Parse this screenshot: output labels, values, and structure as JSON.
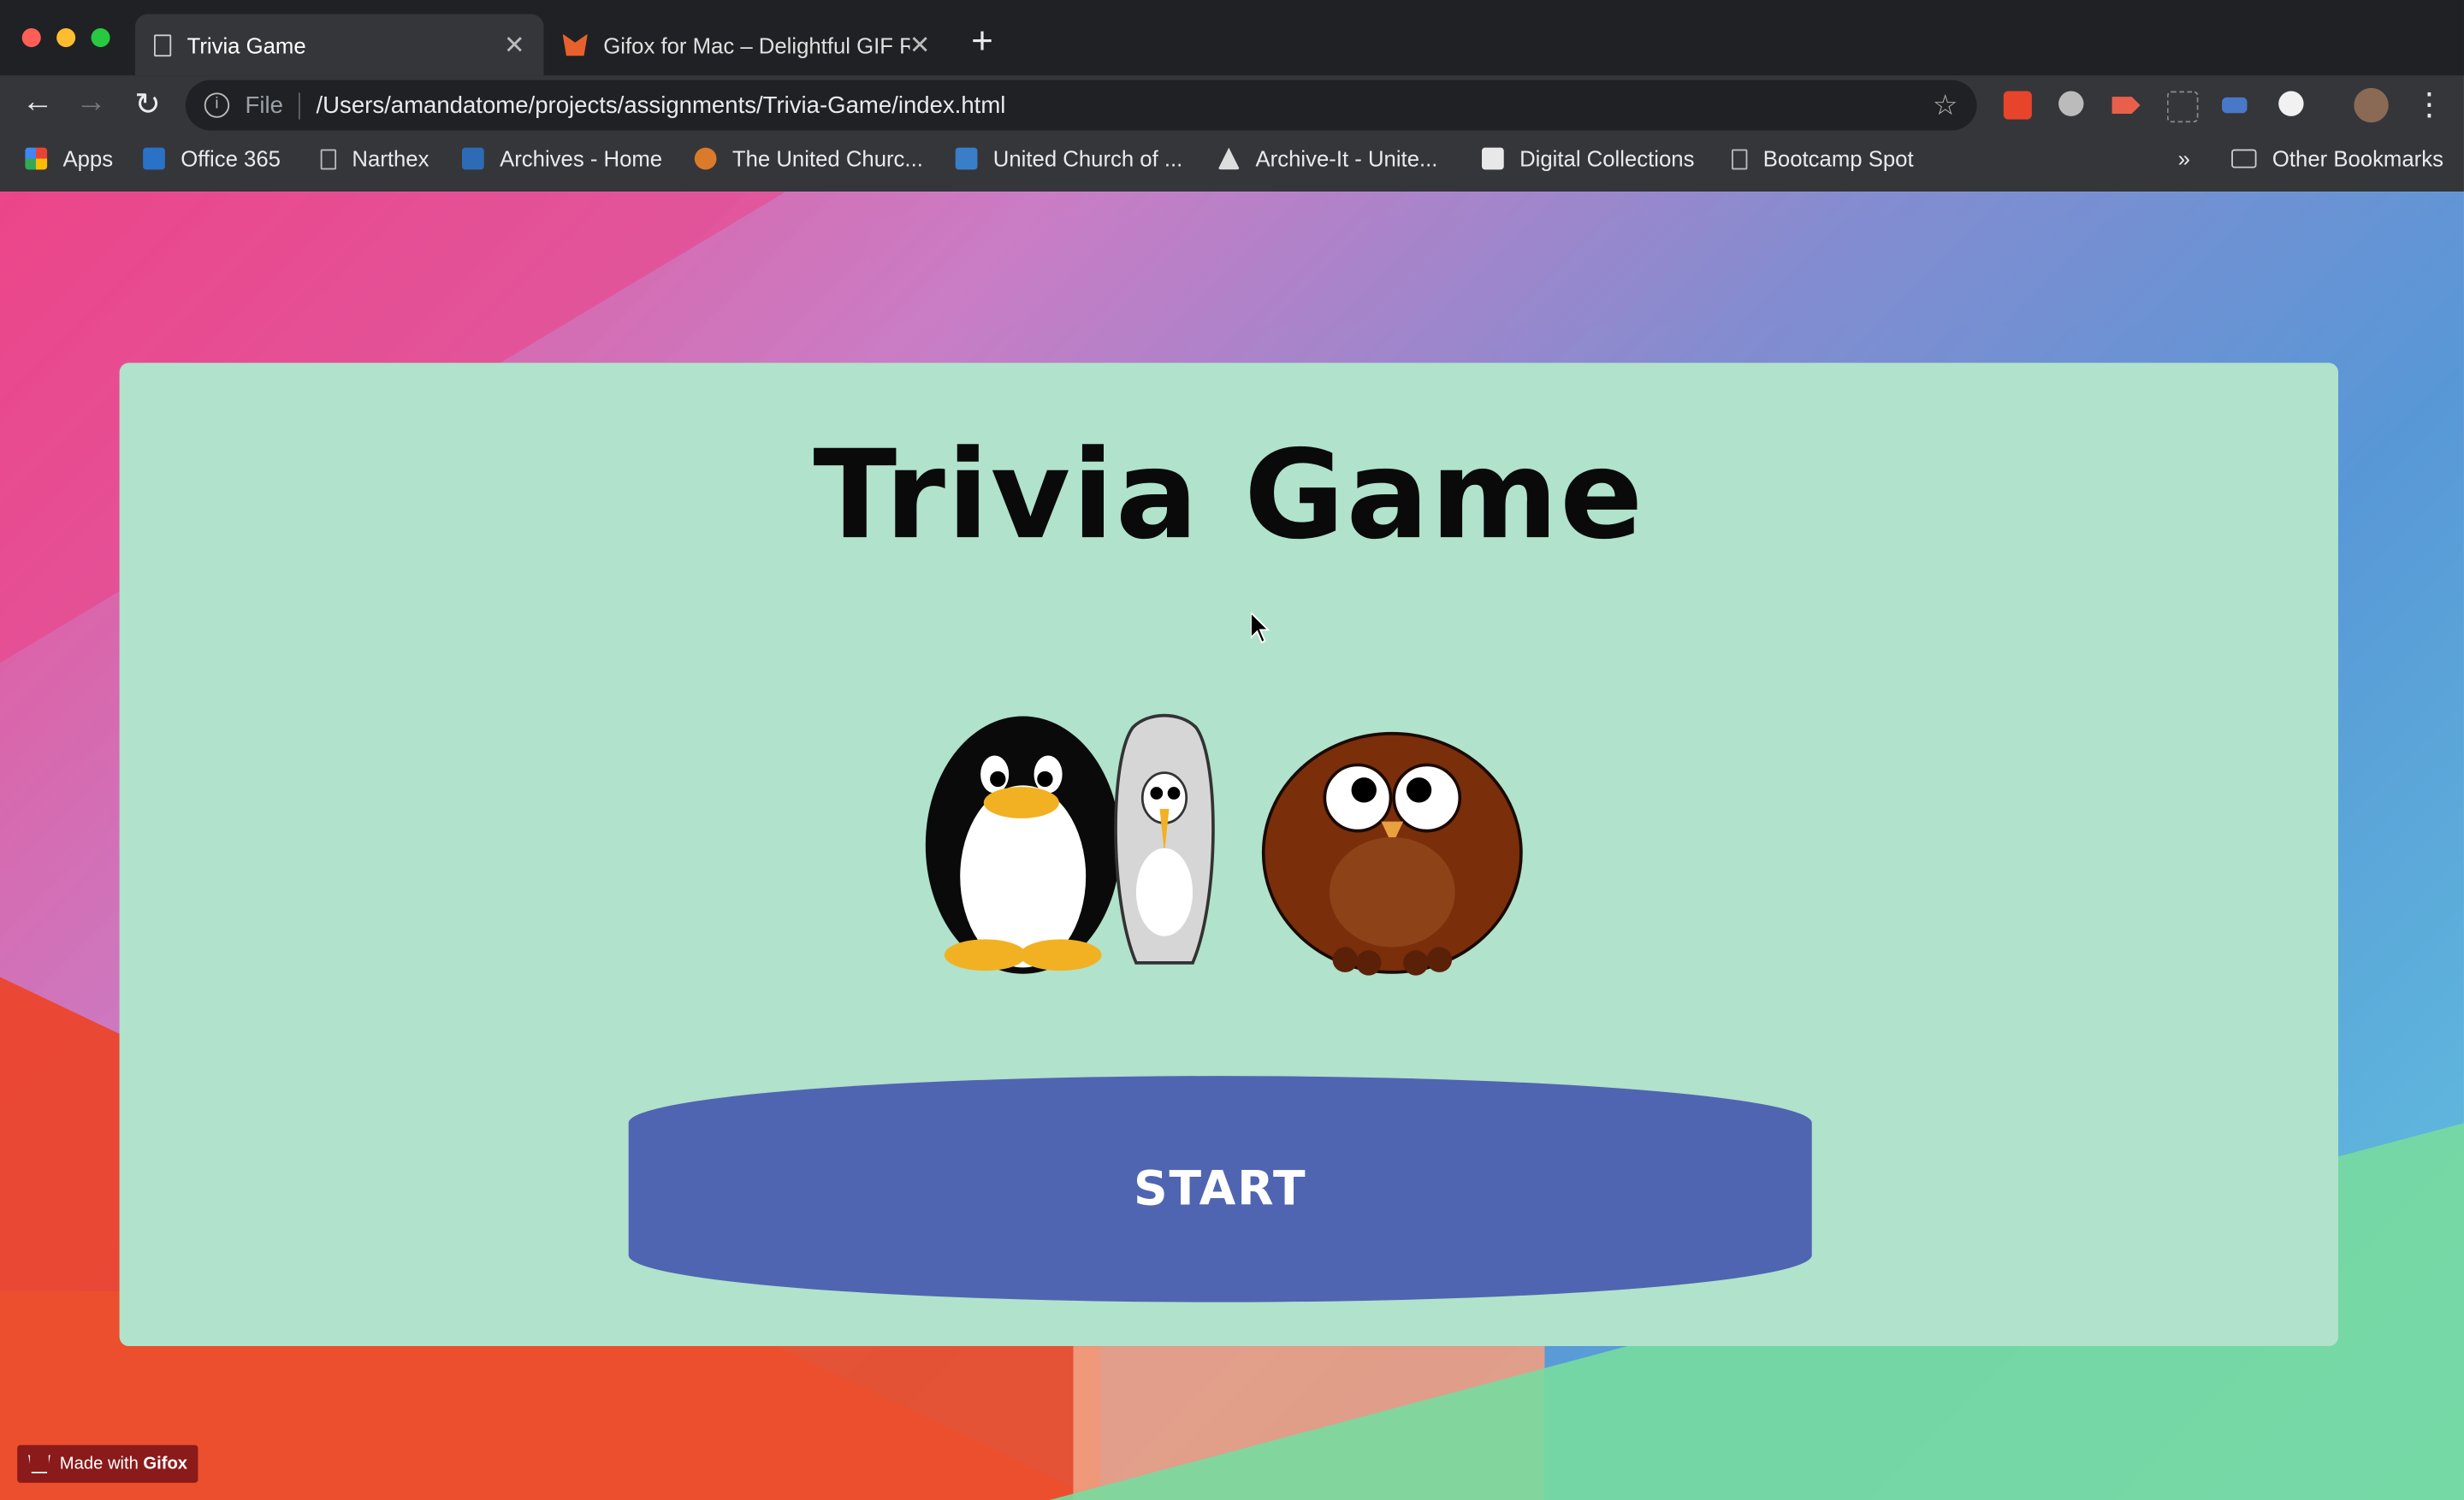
{
  "browser": {
    "tabs": [
      {
        "title": "Trivia Game",
        "active": true,
        "icon": "page-icon"
      },
      {
        "title": "Gifox for Mac – Delightful GIF R",
        "active": false,
        "icon": "gifox-fox-icon"
      }
    ],
    "address": {
      "scheme_label": "File",
      "url": "/Users/amandatome/projects/assignments/Trivia-Game/index.html"
    },
    "bookmarks": [
      {
        "label": "Apps",
        "icon": "apps-grid-icon"
      },
      {
        "label": "Office 365",
        "icon": "outlook-icon"
      },
      {
        "label": "Narthex",
        "icon": "page-icon"
      },
      {
        "label": "Archives - Home",
        "icon": "sharepoint-icon"
      },
      {
        "label": "The United Churc...",
        "icon": "church-icon"
      },
      {
        "label": "United Church of ...",
        "icon": "ucc-icon"
      },
      {
        "label": "Archive-It - Unite...",
        "icon": "archive-it-icon"
      },
      {
        "label": "Digital Collections",
        "icon": "collection-icon"
      },
      {
        "label": "Bootcamp Spot",
        "icon": "page-icon"
      }
    ],
    "overflow_label": "»",
    "other_bookmarks": "Other Bookmarks"
  },
  "page": {
    "title": "Trivia Game",
    "start_label": "START",
    "animals": [
      "penguin",
      "heron",
      "owl"
    ]
  },
  "watermark": {
    "prefix": "Made with",
    "brand": "Gifox"
  },
  "colors": {
    "card_bg": "#b0e2cc",
    "button_bg": "#5065b1",
    "title_color": "#0a0a0a"
  }
}
